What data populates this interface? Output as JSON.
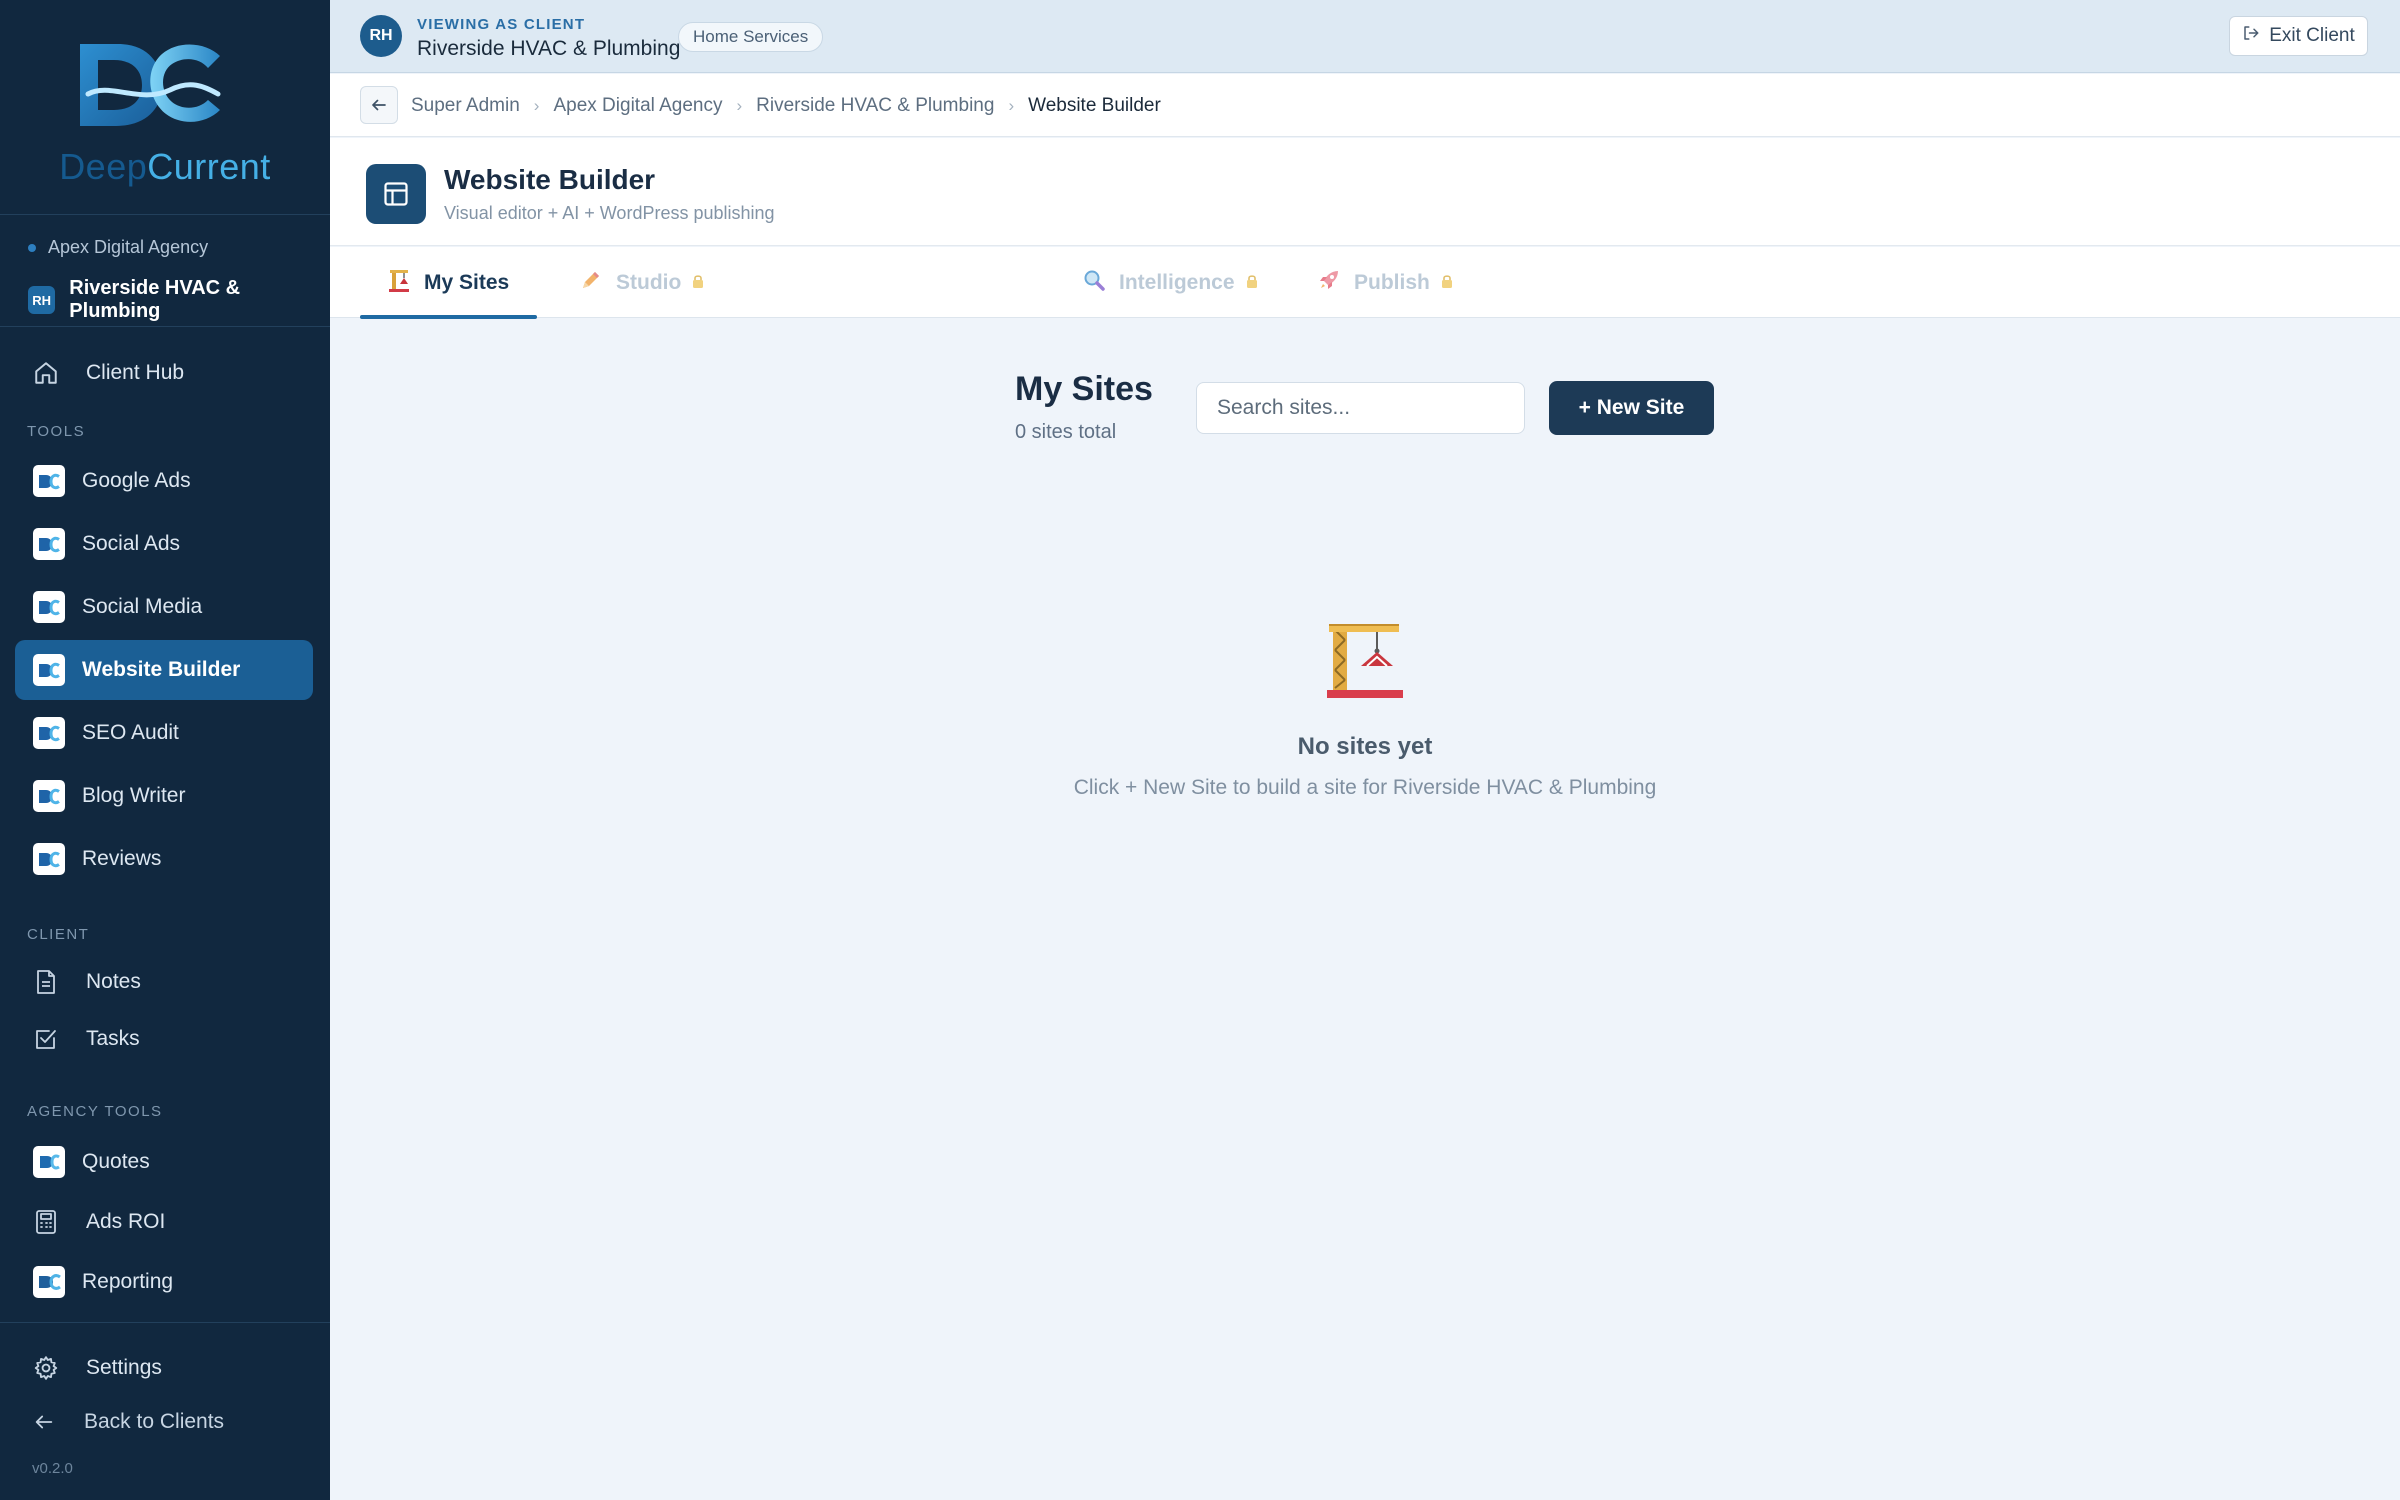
{
  "brand": {
    "name_part1": "Deep",
    "name_part2": "Current",
    "logo_initials": "DC"
  },
  "context": {
    "agency": "Apex Digital Agency",
    "client_initials": "RH",
    "client_name": "Riverside HVAC & Plumbing"
  },
  "sidebar": {
    "client_hub": "Client Hub",
    "tools_label": "TOOLS",
    "tools": [
      {
        "label": "Google Ads",
        "icon": "google-ads-app-icon"
      },
      {
        "label": "Social Ads",
        "icon": "social-ads-app-icon"
      },
      {
        "label": "Social Media",
        "icon": "social-media-app-icon"
      },
      {
        "label": "Website Builder",
        "icon": "website-builder-app-icon"
      },
      {
        "label": "SEO Audit",
        "icon": "seo-audit-app-icon"
      },
      {
        "label": "Blog Writer",
        "icon": "blog-writer-app-icon"
      },
      {
        "label": "Reviews",
        "icon": "reviews-app-icon"
      }
    ],
    "client_label": "CLIENT",
    "client_items": [
      {
        "label": "Notes",
        "icon": "notes-icon"
      },
      {
        "label": "Tasks",
        "icon": "tasks-icon"
      }
    ],
    "agency_label": "AGENCY TOOLS",
    "agency_items": [
      {
        "label": "Quotes",
        "icon": "quotes-app-icon"
      },
      {
        "label": "Ads ROI",
        "icon": "calculator-icon"
      },
      {
        "label": "Reporting",
        "icon": "reporting-app-icon"
      }
    ],
    "settings": "Settings",
    "back_to_clients": "Back to Clients",
    "version": "v0.2.0",
    "active_item": "Website Builder"
  },
  "banner": {
    "initials": "RH",
    "label": "VIEWING AS CLIENT",
    "client_name": "Riverside HVAC & Plumbing",
    "industry_tag": "Home Services",
    "exit_label": "Exit Client"
  },
  "breadcrumb": [
    "Super Admin",
    "Apex Digital Agency",
    "Riverside HVAC & Plumbing",
    "Website Builder"
  ],
  "page": {
    "title": "Website Builder",
    "subtitle": "Visual editor + AI + WordPress publishing"
  },
  "tabs": [
    {
      "label": "My Sites",
      "icon": "crane-icon",
      "locked": false,
      "active": true
    },
    {
      "label": "Studio",
      "icon": "pencil-icon",
      "locked": true,
      "active": false
    },
    {
      "label": "Intelligence",
      "icon": "magnifier-icon",
      "locked": true,
      "active": false
    },
    {
      "label": "Publish",
      "icon": "rocket-icon",
      "locked": true,
      "active": false
    }
  ],
  "sites": {
    "title": "My Sites",
    "count_text": "0 sites total",
    "search_placeholder": "Search sites...",
    "new_button": "+ New Site",
    "empty_title": "No sites yet",
    "empty_subtitle": "Click + New Site to build a site for Riverside HVAC & Plumbing"
  },
  "colors": {
    "sidebar_bg": "#11283f",
    "accent": "#1e6aa3",
    "active_nav": "#1b5f95",
    "primary_button": "#1d3a56",
    "page_bg": "#eff4fa"
  }
}
